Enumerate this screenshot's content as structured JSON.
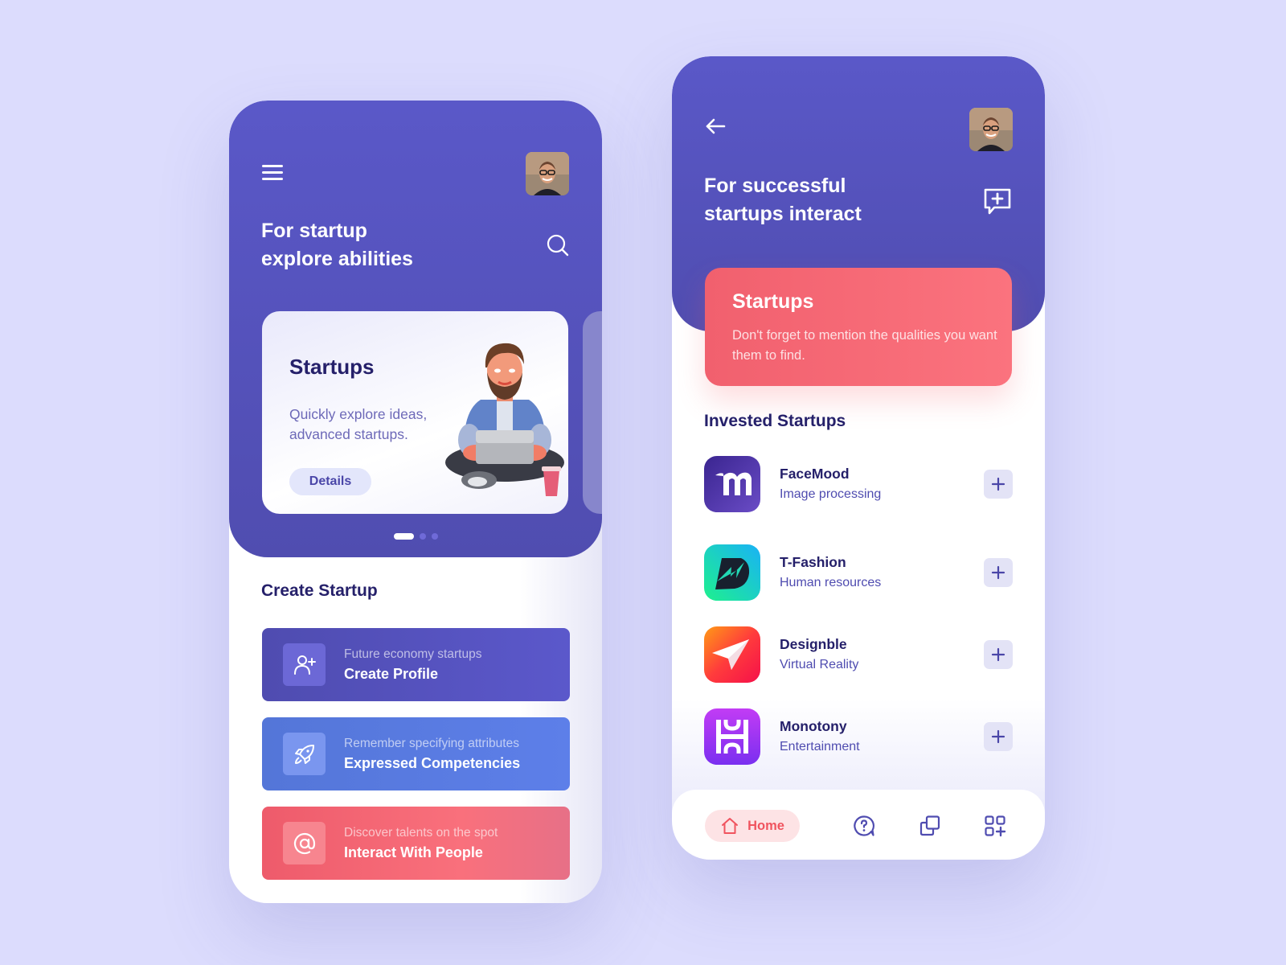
{
  "colors": {
    "background": "#dcdcfd",
    "primary": "#5552c0",
    "heading": "#25206a",
    "accent_red": "#f5646f",
    "accent_blue": "#5a7be3"
  },
  "left_screen": {
    "header": {
      "menu_icon": "menu-icon",
      "avatar_alt": "user-avatar",
      "title_lines": [
        "For startup",
        "explore abilities"
      ],
      "search_icon": "search-icon"
    },
    "carousel": {
      "card": {
        "title": "Startups",
        "description": "Quickly explore ideas, advanced startups.",
        "button_label": "Details",
        "illustration": "man-with-laptop-illustration"
      },
      "pages": 3,
      "active_page": 1
    },
    "create_section": {
      "title": "Create Startup",
      "items": [
        {
          "subtitle": "Future economy startups",
          "title": "Create Profile",
          "icon": "user-plus-icon",
          "color": "#5552c0"
        },
        {
          "subtitle": "Remember specifying attributes",
          "title": "Expressed Competencies",
          "icon": "rocket-icon",
          "color": "#5a7be3"
        },
        {
          "subtitle": "Discover talents on the spot",
          "title": "Interact With People",
          "icon": "at-sign-icon",
          "color": "#f5646f"
        }
      ]
    }
  },
  "right_screen": {
    "header": {
      "back_icon": "arrow-left-icon",
      "avatar_alt": "user-avatar",
      "title_lines": [
        "For successful",
        "startups interact"
      ],
      "action_icon": "message-plus-icon"
    },
    "promo": {
      "title": "Startups",
      "description": "Don't forget to mention the qualities you want them to find."
    },
    "invested": {
      "title": "Invested Startups",
      "items": [
        {
          "name": "FaceMood",
          "category": "Image processing",
          "logo": "facemood-logo"
        },
        {
          "name": "T-Fashion",
          "category": "Human resources",
          "logo": "tfashion-logo"
        },
        {
          "name": "Designble",
          "category": "Virtual Reality",
          "logo": "designble-logo"
        },
        {
          "name": "Monotony",
          "category": "Entertainment",
          "logo": "monotony-logo"
        }
      ]
    },
    "bottom_nav": {
      "items": [
        {
          "label": "Home",
          "icon": "home-icon",
          "active": true
        },
        {
          "label": "",
          "icon": "help-chat-icon",
          "active": false
        },
        {
          "label": "",
          "icon": "copy-icon",
          "active": false
        },
        {
          "label": "",
          "icon": "apps-add-icon",
          "active": false
        }
      ]
    }
  }
}
